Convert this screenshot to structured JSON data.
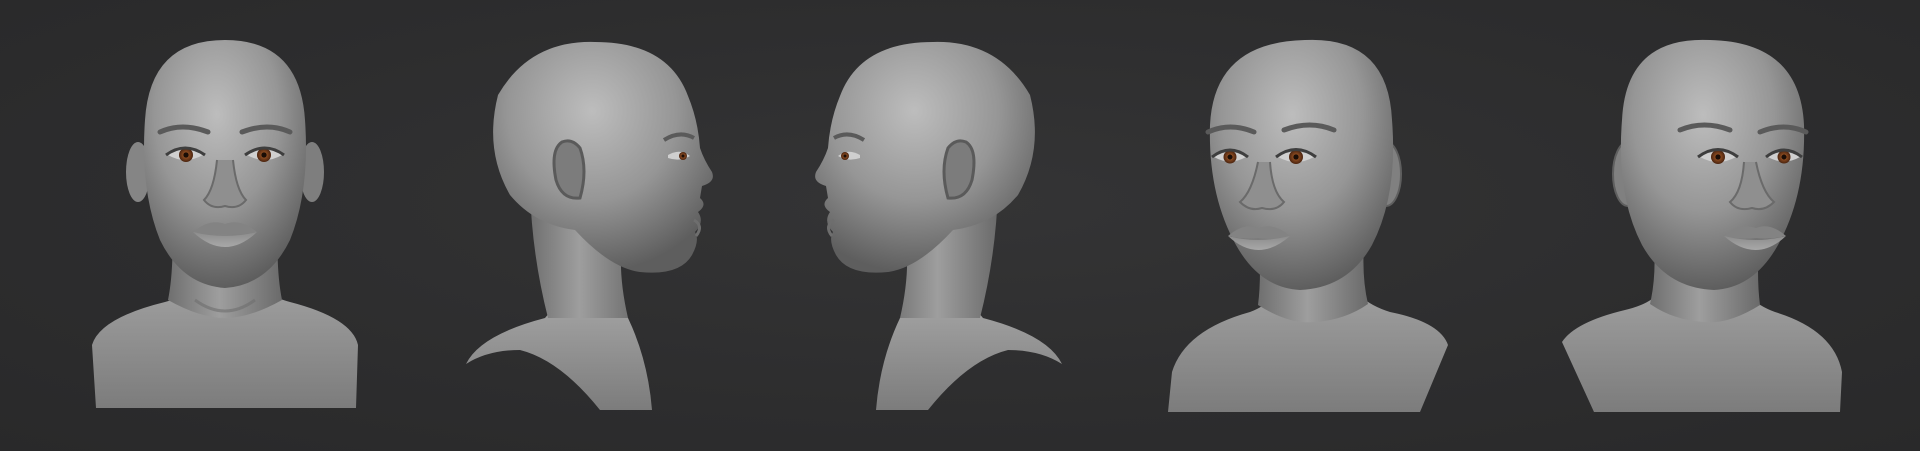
{
  "scene": {
    "background": "#2e2e2f",
    "material": "#8a8a8a",
    "material_highlight": "#b4b4b4",
    "material_shadow": "#4c4c4c",
    "eye_color": "#7a3f1c",
    "views": [
      {
        "name": "front"
      },
      {
        "name": "profile-right"
      },
      {
        "name": "profile-left"
      },
      {
        "name": "three-quarter-left"
      },
      {
        "name": "three-quarter-right"
      }
    ]
  }
}
